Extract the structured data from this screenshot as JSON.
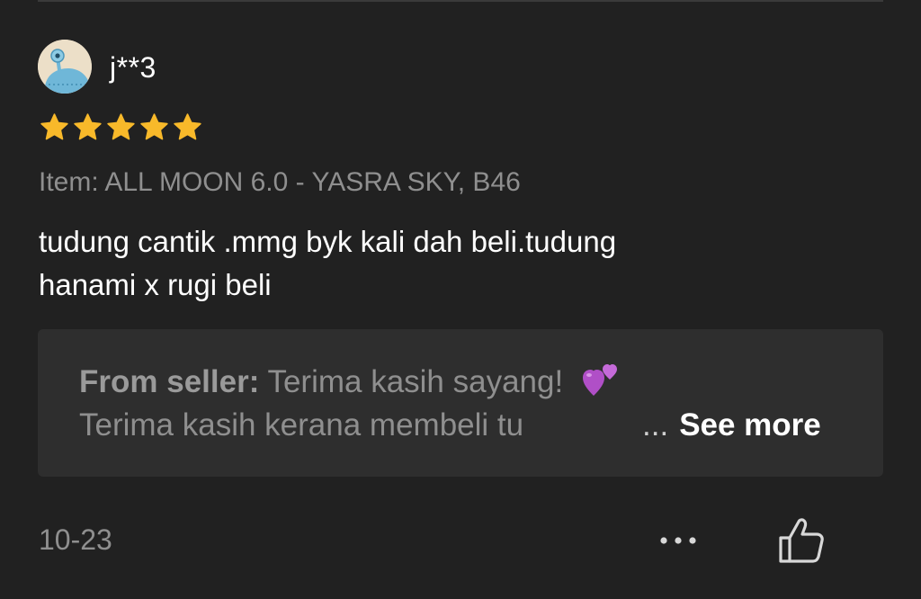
{
  "review": {
    "username": "j**3",
    "rating": 5,
    "max_rating": 5,
    "item_line": "Item: ALL MOON 6.0 - YASRA SKY, B46",
    "text_line1": "tudung cantik .mmg byk kali dah beli.tudung",
    "text_line2": "hanami x rugi beli",
    "date": "10-23"
  },
  "seller_reply": {
    "label": "From seller:",
    "line1": "Terima kasih sayang!",
    "emoji": "two-hearts-emoji",
    "line2": "Terima kasih kerana membeli tu",
    "ellipsis": "...",
    "see_more": "See more"
  },
  "actions": {
    "more_icon": "more-horizontal-icon",
    "like_icon": "thumbs-up-icon"
  },
  "colors": {
    "background": "#212121",
    "card": "#2e2e2e",
    "star": "#f8b92a",
    "muted_text": "#8f8f8f",
    "primary_text": "#ffffff"
  }
}
